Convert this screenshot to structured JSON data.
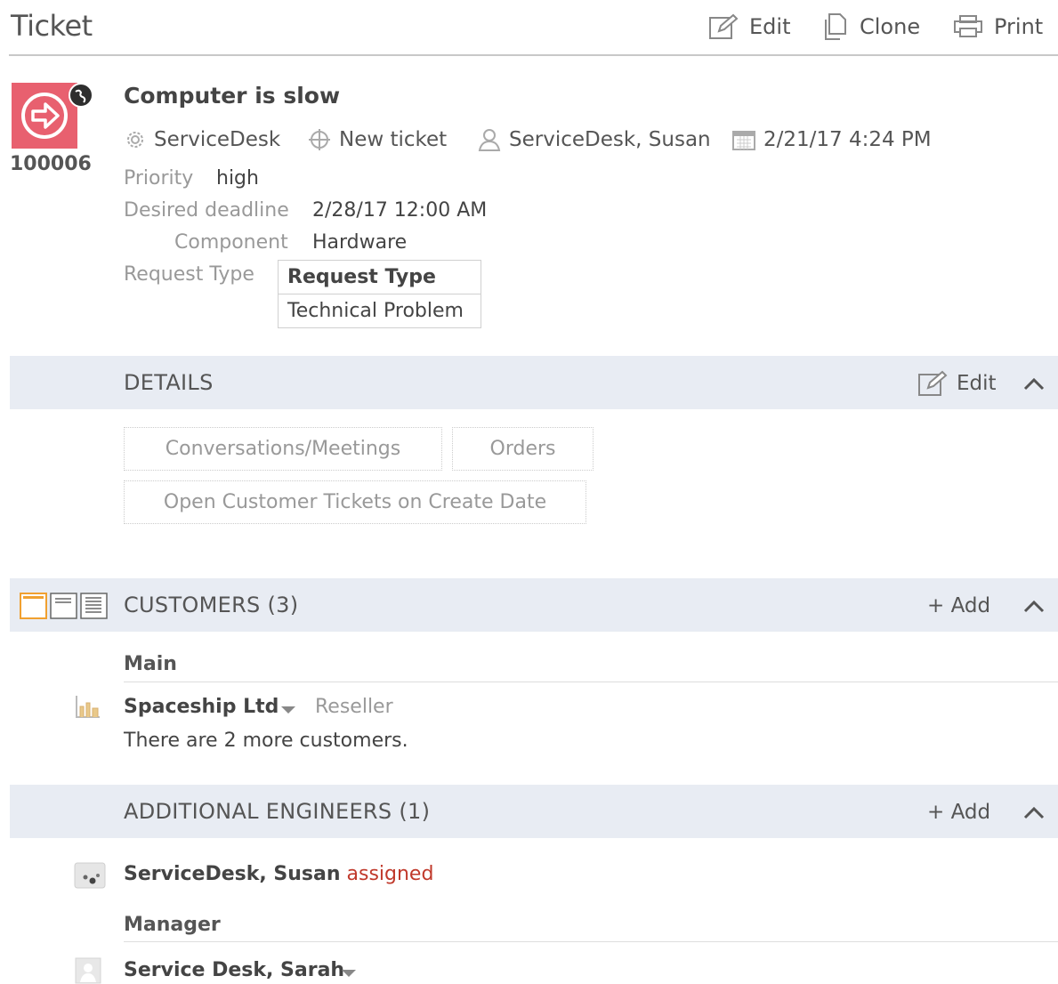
{
  "header": {
    "title": "Ticket",
    "edit_label": "Edit",
    "clone_label": "Clone",
    "print_label": "Print"
  },
  "ticket": {
    "id": "100006",
    "subject": "Computer is slow",
    "category": "ServiceDesk",
    "status": "New ticket",
    "assignee": "ServiceDesk, Susan",
    "created": "2/21/17 4:24 PM",
    "fields": {
      "priority_label": "Priority",
      "priority_value": "high",
      "deadline_label": "Desired deadline",
      "deadline_value": "2/28/17 12:00 AM",
      "component_label": "Component",
      "component_value": "Hardware",
      "request_type_label": "Request Type",
      "request_type_header": "Request Type",
      "request_type_value": "Technical Problem"
    },
    "badge_color": "#e8606f"
  },
  "details": {
    "title": "DETAILS",
    "edit_label": "Edit",
    "tiles": [
      "Conversations/Meetings",
      "Orders",
      "Open Customer Tickets on Create Date"
    ]
  },
  "customers": {
    "title": "CUSTOMERS (3)",
    "add_label": "+ Add",
    "group_label": "Main",
    "customer_name": "Spaceship Ltd",
    "customer_role": "Reseller",
    "more_text": "There are 2 more customers."
  },
  "engineers": {
    "title": "ADDITIONAL ENGINEERS (1)",
    "add_label": "+ Add",
    "engineer_name": "ServiceDesk, Susan",
    "engineer_status": "assigned",
    "manager_label": "Manager",
    "manager_name": "Service Desk, Sarah"
  },
  "colors": {
    "section_bg": "#e8ecf3",
    "status_red": "#c0392b",
    "layout_icon_active": "#f0a030"
  }
}
